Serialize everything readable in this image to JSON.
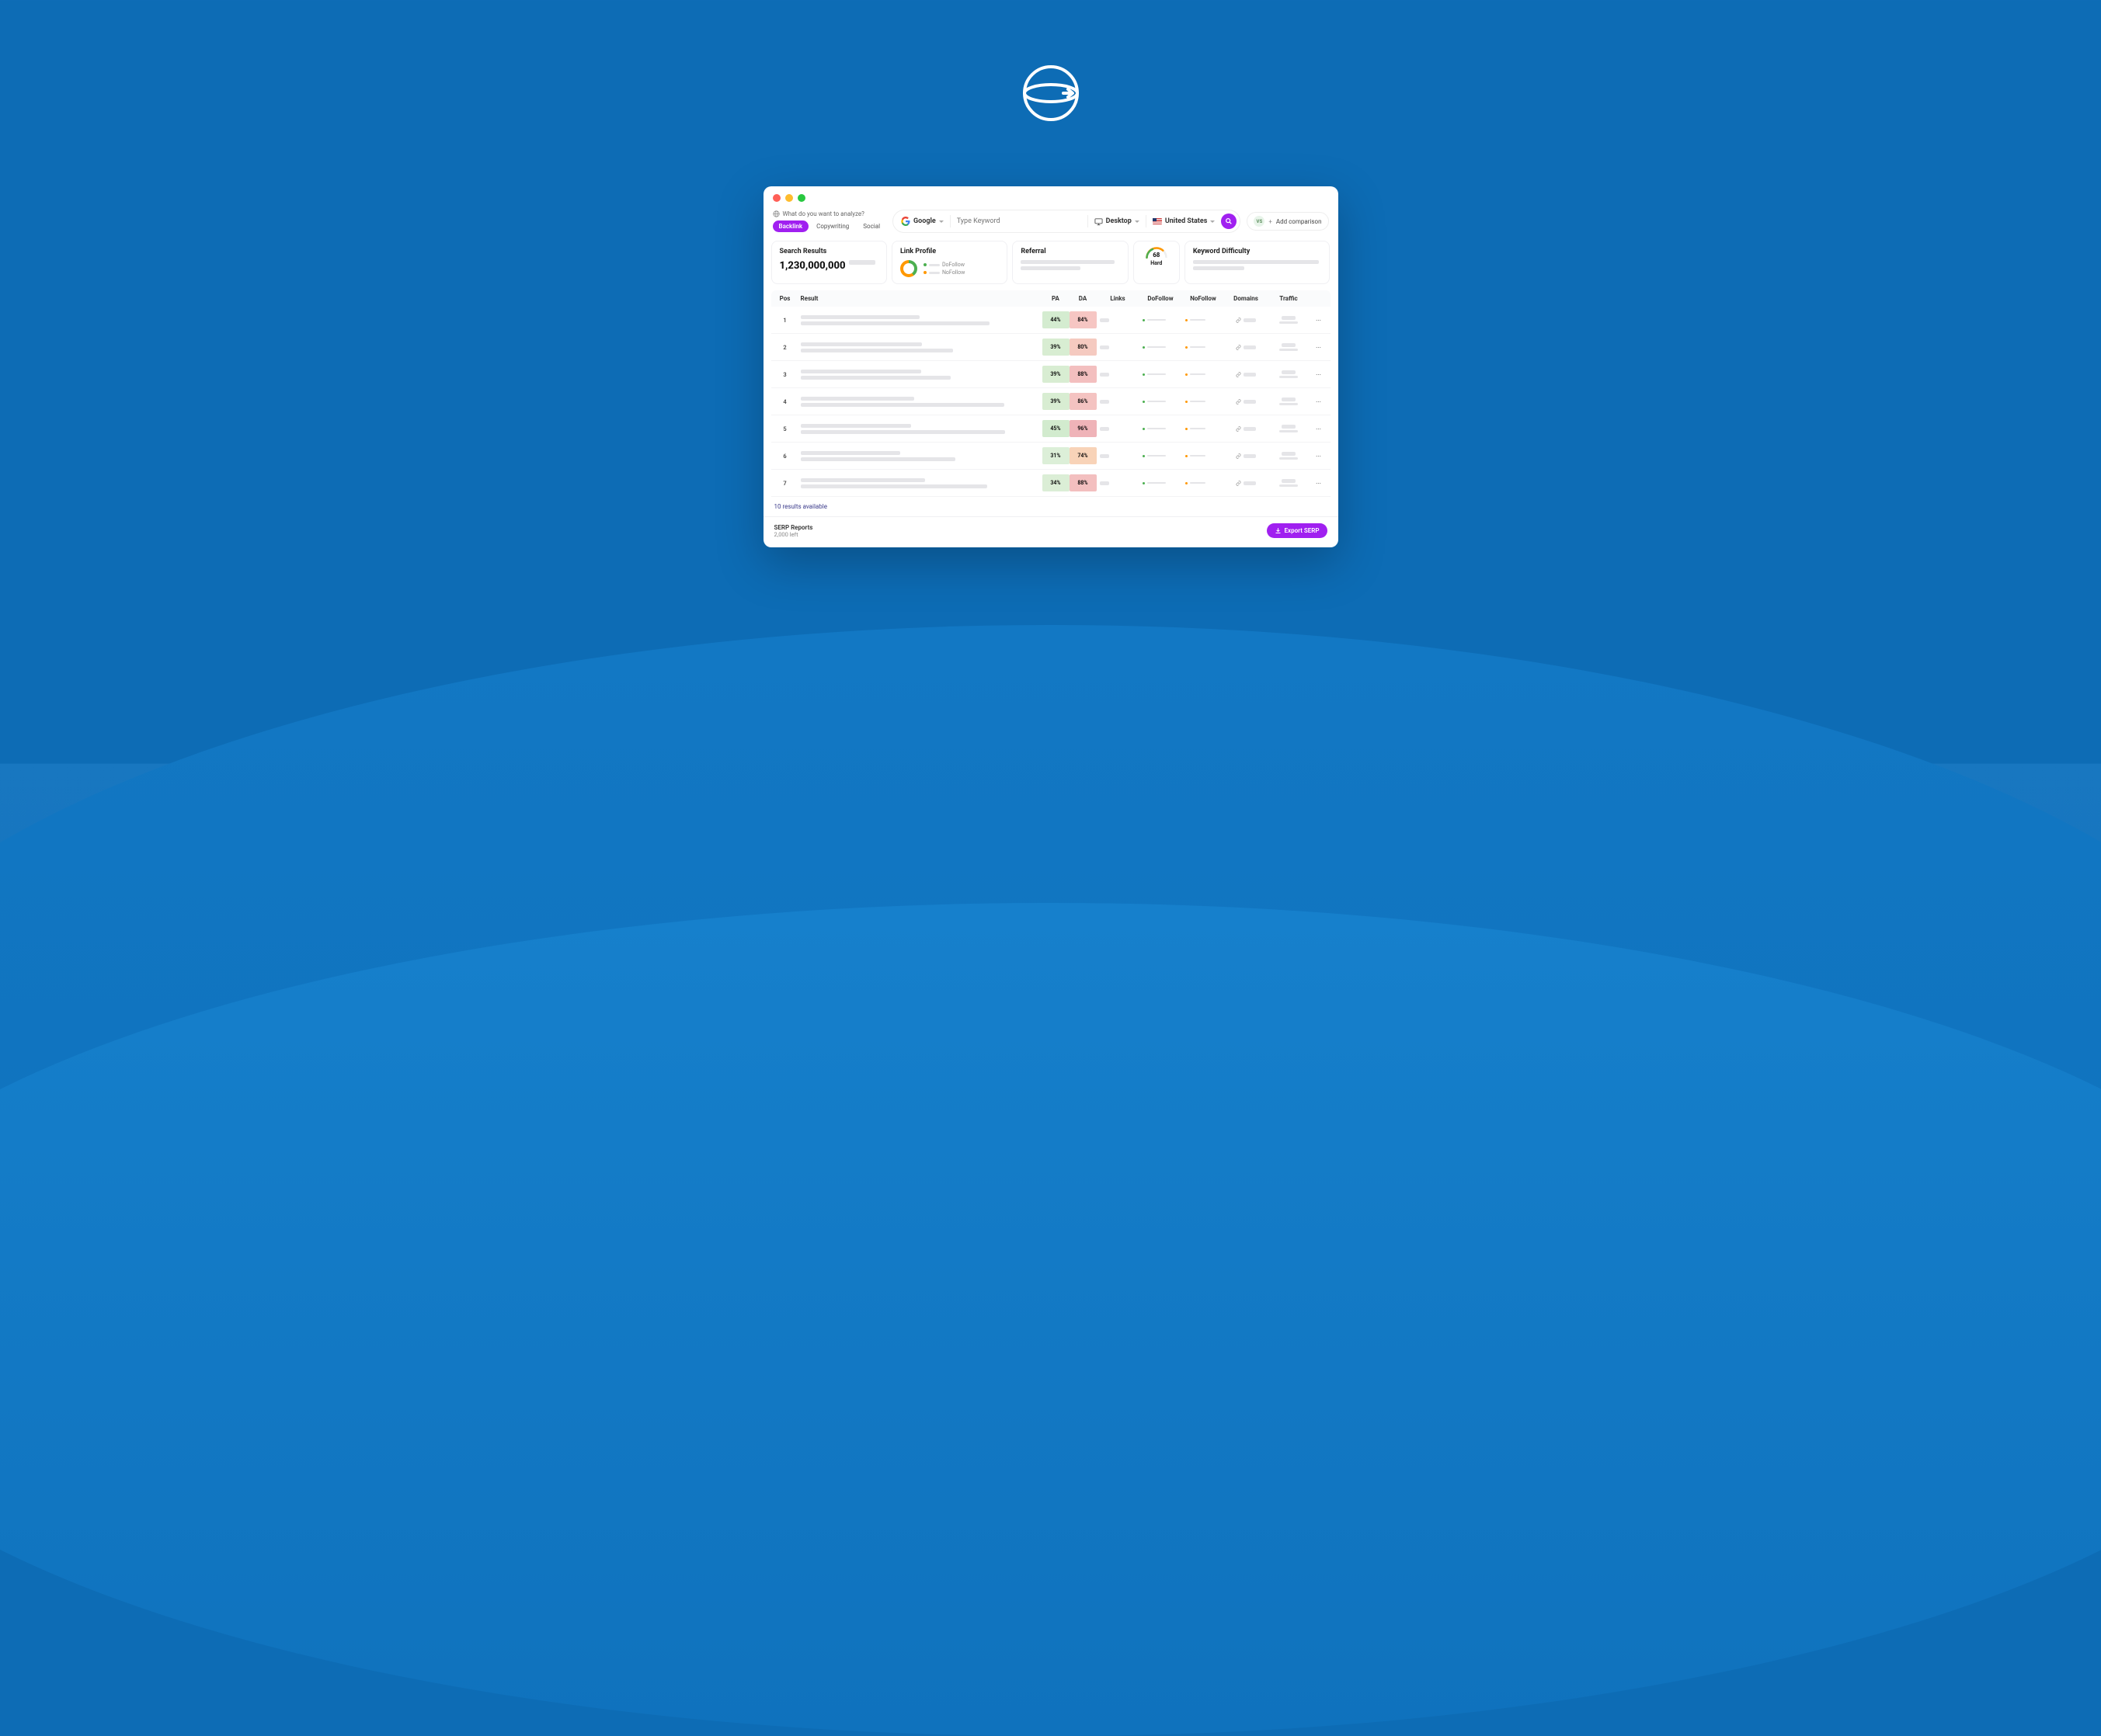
{
  "brand": {
    "logo_alt": "spinning globe logo"
  },
  "toolbar": {
    "prompt": "What do you want to analyze?",
    "tabs": [
      {
        "label": "Backlink",
        "active": true
      },
      {
        "label": "Copywriting",
        "active": false
      },
      {
        "label": "Social",
        "active": false
      }
    ],
    "engine": "Google",
    "search_placeholder": "Type Keyword",
    "device": "Desktop",
    "country": "United States",
    "compare_label": "Add comparison",
    "vs_badge": "VS"
  },
  "cards": {
    "search_results": {
      "title": "Search Results",
      "value": "1,230,000,000"
    },
    "link_profile": {
      "title": "Link Profile",
      "legend": [
        {
          "label": "DoFollow",
          "color": "#4caf50"
        },
        {
          "label": "NoFollow",
          "color": "#ff9800"
        }
      ]
    },
    "referral": {
      "title": "Referral"
    },
    "difficulty": {
      "title": "Keyword Difficulty",
      "score": "68",
      "level": "Hard"
    }
  },
  "table": {
    "headers": [
      "Pos",
      "Result",
      "PA",
      "DA",
      "Links",
      "DoFollow",
      "NoFollow",
      "Domains",
      "Traffic"
    ],
    "rows": [
      {
        "pos": "1",
        "pa": "44%",
        "pa_bg": "#d4ecd0",
        "da": "84%",
        "da_bg": "#f6c6c3"
      },
      {
        "pos": "2",
        "pa": "39%",
        "pa_bg": "#d8edd2",
        "da": "80%",
        "da_bg": "#f5cac0"
      },
      {
        "pos": "3",
        "pa": "39%",
        "pa_bg": "#d8edd2",
        "da": "88%",
        "da_bg": "#f3bfbf"
      },
      {
        "pos": "4",
        "pa": "39%",
        "pa_bg": "#d8edd2",
        "da": "86%",
        "da_bg": "#f4c3c1"
      },
      {
        "pos": "5",
        "pa": "45%",
        "pa_bg": "#d2ebce",
        "da": "96%",
        "da_bg": "#efb3b8"
      },
      {
        "pos": "6",
        "pa": "31%",
        "pa_bg": "#dcefd8",
        "da": "74%",
        "da_bg": "#f8d3b8"
      },
      {
        "pos": "7",
        "pa": "34%",
        "pa_bg": "#dbeed6",
        "da": "88%",
        "da_bg": "#f3bfbf"
      }
    ],
    "footer_note": "10 results available"
  },
  "bottom": {
    "title": "SERP Reports",
    "remaining": "2,000 left",
    "export_label": "Export SERP"
  },
  "colors": {
    "accent": "#a020f0",
    "green": "#4caf50",
    "orange": "#ff9800"
  }
}
